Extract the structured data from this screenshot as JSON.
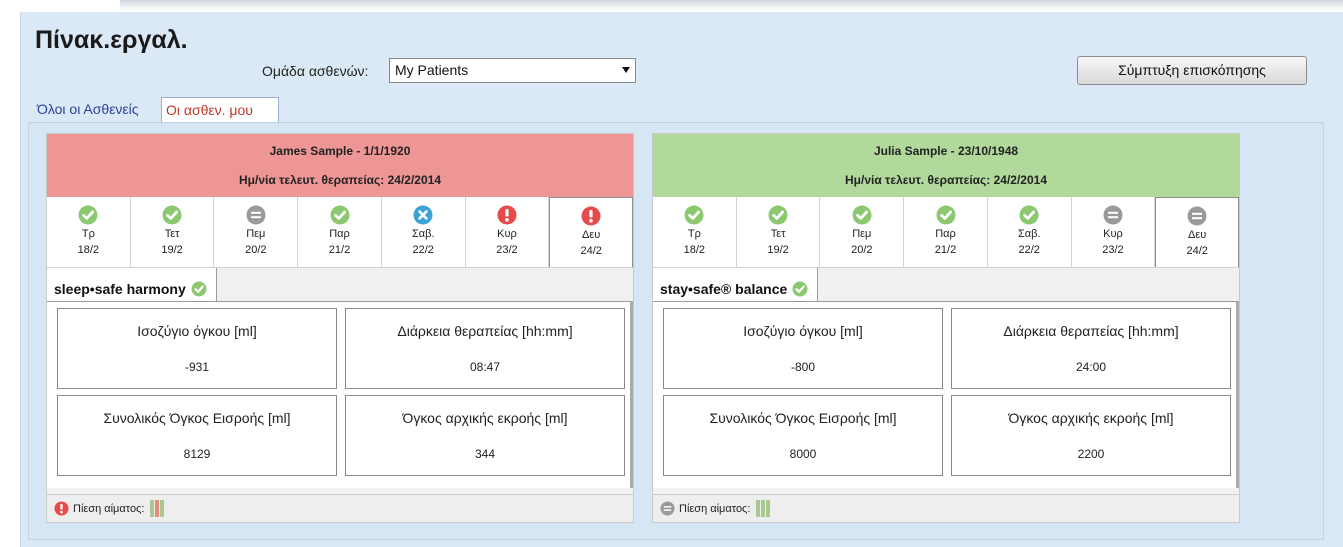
{
  "header": {
    "title": "Πίνακ.εργαλ.",
    "group_label": "Ομάδα ασθενών:",
    "group_value": "My Patients",
    "collapse_button": "Σύμπτυξη επισκόπησης"
  },
  "tabs": [
    {
      "label": "Όλοι οι Ασθενείς"
    },
    {
      "label": "Οι ασθεν. μου"
    }
  ],
  "patients": [
    {
      "name": "James Sample - 1/1/1920",
      "last_therapy": "Ημ/νία τελευτ. θεραπείας: 24/2/2014",
      "header_color": "#ee9595",
      "days": [
        {
          "day": "Τρ",
          "date": "18/2",
          "status": "ok"
        },
        {
          "day": "Τετ",
          "date": "19/2",
          "status": "ok"
        },
        {
          "day": "Πεμ",
          "date": "20/2",
          "status": "none"
        },
        {
          "day": "Παρ",
          "date": "21/2",
          "status": "ok"
        },
        {
          "day": "Σαβ.",
          "date": "22/2",
          "status": "error"
        },
        {
          "day": "Κυρ",
          "date": "23/2",
          "status": "alert"
        },
        {
          "day": "Δευ",
          "date": "24/2",
          "status": "alert"
        }
      ],
      "therapy": "sleep•safe harmony",
      "metrics": [
        {
          "label": "Ισοζύγιο όγκου [ml]",
          "value": "-931"
        },
        {
          "label": "Διάρκεια θεραπείας [hh:mm]",
          "value": "08:47"
        },
        {
          "label": "Συνολικός Όγκος Εισροής [ml]",
          "value": "8129"
        },
        {
          "label": "Όγκος αρχικής εκροής [ml]",
          "value": "344"
        }
      ],
      "footer": {
        "label": "Πίεση αίματος:",
        "status": "alert"
      }
    },
    {
      "name": "Julia Sample - 23/10/1948",
      "last_therapy": "Ημ/νία τελευτ. θεραπείας: 24/2/2014",
      "header_color": "#b2d99c",
      "days": [
        {
          "day": "Τρ",
          "date": "18/2",
          "status": "ok"
        },
        {
          "day": "Τετ",
          "date": "19/2",
          "status": "ok"
        },
        {
          "day": "Πεμ",
          "date": "20/2",
          "status": "ok"
        },
        {
          "day": "Παρ",
          "date": "21/2",
          "status": "ok"
        },
        {
          "day": "Σαβ.",
          "date": "22/2",
          "status": "ok"
        },
        {
          "day": "Κυρ",
          "date": "23/2",
          "status": "none"
        },
        {
          "day": "Δευ",
          "date": "24/2",
          "status": "none"
        }
      ],
      "therapy": "stay•safe® balance",
      "metrics": [
        {
          "label": "Ισοζύγιο όγκου [ml]",
          "value": "-800"
        },
        {
          "label": "Διάρκεια θεραπείας [hh:mm]",
          "value": "24:00"
        },
        {
          "label": "Συνολικός Όγκος Εισροής [ml]",
          "value": "8000"
        },
        {
          "label": "Όγκος αρχικής εκροής [ml]",
          "value": "2200"
        }
      ],
      "footer": {
        "label": "Πίεση αίματος:",
        "status": "none"
      }
    }
  ],
  "colors": {
    "ok": "#8cc870",
    "error": "#3ba3d6",
    "alert": "#e64a4a",
    "none": "#9a9a9a"
  }
}
